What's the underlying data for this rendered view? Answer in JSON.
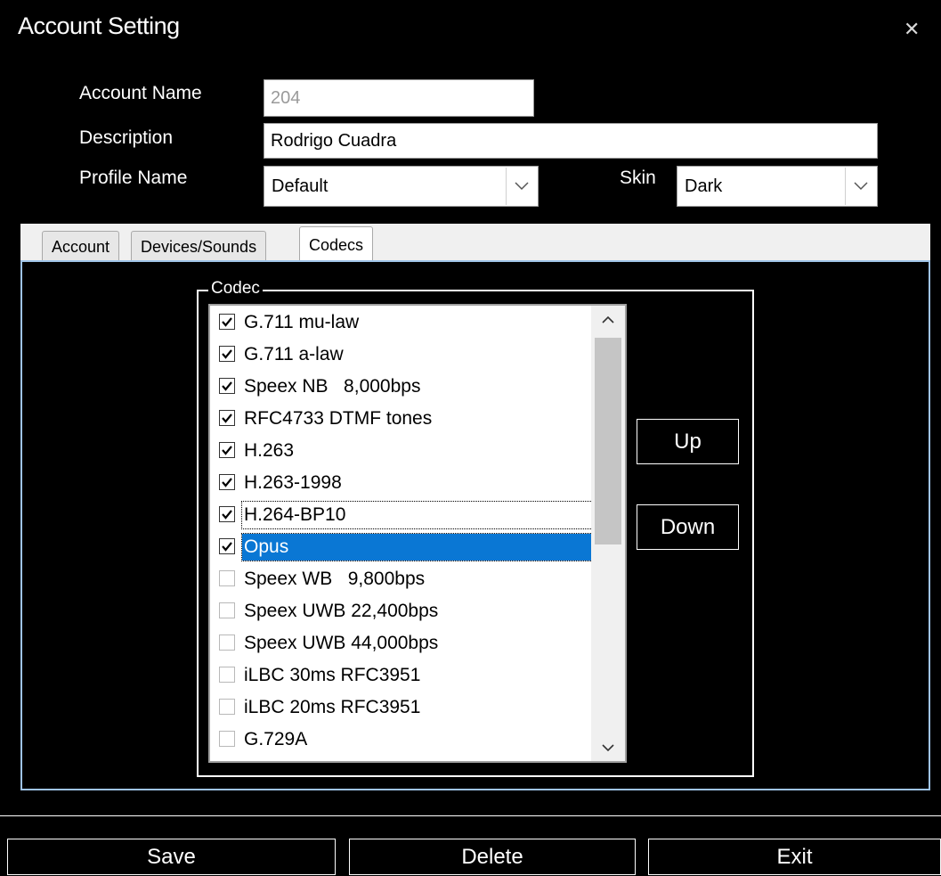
{
  "window": {
    "title": "Account Setting",
    "close_glyph": "✕"
  },
  "form": {
    "account_name_label": "Account Name",
    "account_name_value": "204",
    "description_label": "Description",
    "description_value": "Rodrigo Cuadra",
    "profile_name_label": "Profile Name",
    "profile_name_value": "Default",
    "skin_label": "Skin",
    "skin_value": "Dark"
  },
  "tabs": [
    {
      "label": "Account",
      "active": false
    },
    {
      "label": "Devices/Sounds",
      "active": false
    },
    {
      "label": "Codecs",
      "active": true
    }
  ],
  "codec_group": {
    "label": "Codec",
    "items": [
      {
        "label": "G.711 mu-law",
        "checked": true
      },
      {
        "label": "G.711 a-law",
        "checked": true
      },
      {
        "label": "Speex NB   8,000bps",
        "checked": true
      },
      {
        "label": "RFC4733 DTMF tones",
        "checked": true
      },
      {
        "label": "H.263",
        "checked": true
      },
      {
        "label": "H.263-1998",
        "checked": true
      },
      {
        "label": "H.264-BP10",
        "checked": true
      },
      {
        "label": "Opus",
        "checked": true,
        "selected": true
      },
      {
        "label": "Speex WB   9,800bps",
        "checked": false
      },
      {
        "label": "Speex UWB 22,400bps",
        "checked": false
      },
      {
        "label": "Speex UWB 44,000bps",
        "checked": false
      },
      {
        "label": "iLBC 30ms RFC3951",
        "checked": false
      },
      {
        "label": "iLBC 20ms RFC3951",
        "checked": false
      },
      {
        "label": "G.729A",
        "checked": false
      }
    ],
    "up_label": "Up",
    "down_label": "Down"
  },
  "footer": {
    "save_label": "Save",
    "delete_label": "Delete",
    "exit_label": "Exit"
  },
  "colors": {
    "selection": "#0a77d4",
    "panel_border": "#9fc3e7"
  },
  "icons": {
    "close": "close-icon",
    "dropdown": "chevron-down-icon",
    "check": "check-icon",
    "scroll_up": "chevron-up-icon",
    "scroll_down": "chevron-down-icon"
  }
}
